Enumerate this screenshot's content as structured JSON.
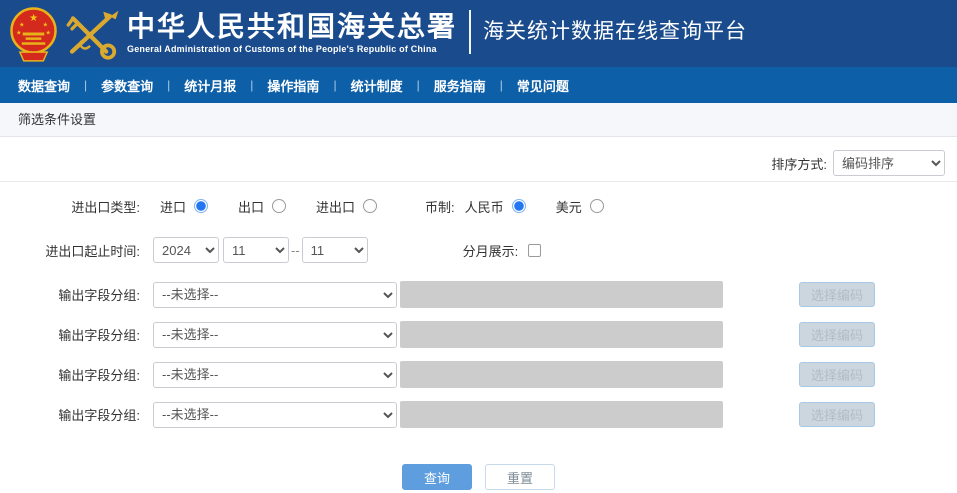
{
  "header": {
    "org_title": "中华人民共和国海关总署",
    "org_subtitle": "General Administration of Customs of the People's Republic of China",
    "platform_title": "海关统计数据在线查询平台"
  },
  "nav": {
    "separator": "|",
    "items": [
      "数据查询",
      "参数查询",
      "统计月报",
      "操作指南",
      "统计制度",
      "服务指南",
      "常见问题"
    ]
  },
  "section": {
    "title": "筛选条件设置"
  },
  "sort": {
    "label": "排序方式:",
    "value": "编码排序"
  },
  "form": {
    "trade_type": {
      "label": "进出口类型:",
      "options": [
        {
          "label": "进口",
          "selected": true
        },
        {
          "label": "出口",
          "selected": false
        },
        {
          "label": "进出口",
          "selected": false
        }
      ]
    },
    "currency": {
      "label": "币制:",
      "options": [
        {
          "label": "人民币",
          "selected": true
        },
        {
          "label": "美元",
          "selected": false
        }
      ]
    },
    "date_range": {
      "label": "进出口起止时间:",
      "year": "2024",
      "start_month": "11",
      "separator": "--",
      "end_month": "11"
    },
    "monthly": {
      "label": "分月展示:",
      "checked": false
    },
    "output_groups": {
      "label": "输出字段分组:",
      "value": "--未选择--",
      "button_label": "选择编码"
    }
  },
  "actions": {
    "query_label": "查询",
    "reset_label": "重置"
  },
  "colors": {
    "header_bg": "#1a4b8c",
    "nav_bg": "#0d5fa8",
    "accent_blue": "#5e9ede",
    "radio_checked": "#2476f2",
    "disabled_input": "#cccccc",
    "emblem_red": "#d42a1d",
    "gold": "#d9a930"
  }
}
